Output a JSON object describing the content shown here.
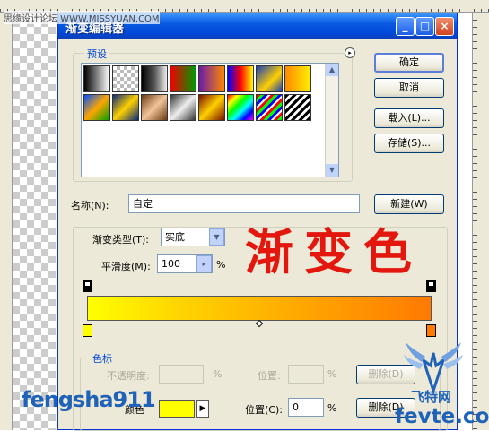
{
  "window": {
    "title": "渐变编辑器",
    "min_glyph": "_",
    "max_glyph": "□",
    "close_glyph": "×"
  },
  "presets": {
    "legend": "预设",
    "menu_glyph": "▸",
    "scroll_up": "▲",
    "scroll_down": "▼",
    "row1": [
      "linear-gradient(90deg,#000,#fff)",
      "repeating-conic-gradient(#bbb 0 25%, #fff 0 50%) 0 0/8px 8px",
      "linear-gradient(90deg,#000,#555 50%,#eee)",
      "linear-gradient(90deg,#e00,#090)",
      "linear-gradient(90deg,#6a1ca8,#f80)",
      "linear-gradient(90deg,#00f,#f00,#ff0)",
      "linear-gradient(135deg,#1a3fb8,#ffd000 60%,#1a3fb8)",
      "linear-gradient(90deg,#ff8a00,#ffee00)"
    ],
    "row2": [
      "linear-gradient(135deg,#0050ff,#ffa500 50%,#00a000)",
      "linear-gradient(135deg,#0a2a7a,#ffd000 50%,#0a2a7a)",
      "linear-gradient(135deg,#6a3a10,#f2c49a 50%,#6a3a10)",
      "linear-gradient(135deg,#333,#eee 50%,#333)",
      "linear-gradient(135deg,#7a1000,#ffd000 50%,#7a1000)",
      "linear-gradient(135deg,#f00,#ff0,#0f0,#0ff,#00f,#f0f)",
      "repeating-linear-gradient(135deg,#f00 0 3px,#0f0 3px 6px,#00f 6px 9px,#fff 9px 11px)",
      "repeating-linear-gradient(135deg,#000 0 3px,#fff 3px 6px)"
    ]
  },
  "buttons": {
    "ok": "确定",
    "cancel": "取消",
    "load": "载入(L)...",
    "save": "存储(S)...",
    "new": "新建(W)"
  },
  "name": {
    "label": "名称(N):",
    "value": "自定"
  },
  "gradient": {
    "type_label": "渐变类型(T):",
    "type_value": "实底",
    "smoothness_label": "平滑度(M):",
    "smoothness_value": "100",
    "smoothness_unit": "%",
    "stepper_glyph": "▸",
    "dropdown_glyph": "▼",
    "stop_colors": [
      "#ffff00",
      "#ff7a00"
    ]
  },
  "overlay_text": "渐变色",
  "color_stops": {
    "legend": "色标",
    "opacity_label": "不透明度:",
    "opacity_unit": "%",
    "position_label_top": "位置:",
    "position_unit_top": "%",
    "delete_top": "删除(D)",
    "color_label": "颜色",
    "color_menu_glyph": "▶",
    "position_label": "位置(C):",
    "position_value": "0",
    "position_unit": "%",
    "delete_bottom": "删除(D)",
    "color_value": "#ffff00"
  },
  "watermarks": {
    "top_left": "思缘设计论坛 WWW.MISSYUAN.COM",
    "left": "fengsha911",
    "right_cn": "飞特网",
    "right_domain": "fevte.com"
  }
}
